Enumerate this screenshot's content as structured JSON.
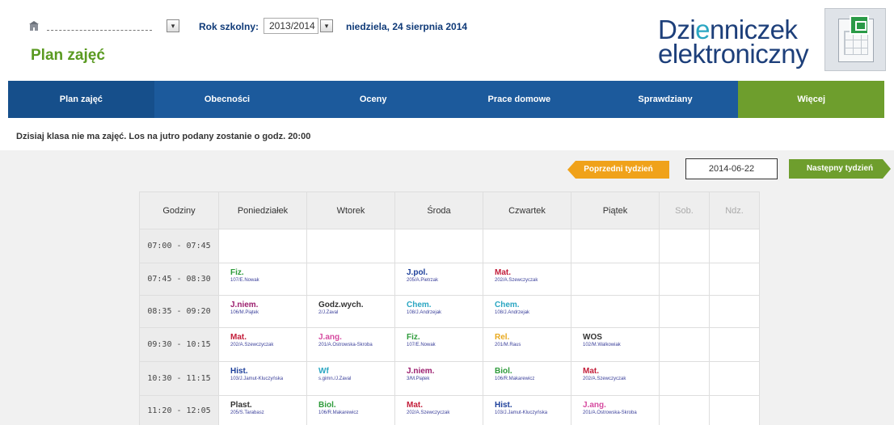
{
  "header": {
    "year_label": "Rok szkolny:",
    "year_value": "2013/2014",
    "date_text": "niedziela, 24 sierpnia 2014",
    "page_title": "Plan zajęć",
    "brand_line1_a": "Dzi",
    "brand_line1_b": "e",
    "brand_line1_c": "nniczek",
    "brand_line2": "elektroniczny"
  },
  "nav": [
    "Plan zajęć",
    "Obecności",
    "Oceny",
    "Prace domowe",
    "Sprawdziany",
    "Więcej"
  ],
  "info": "Dzisiaj klasa nie ma zajęć. Los na jutro podany zostanie o godz. 20:00",
  "week": {
    "prev_label": "Poprzedni tydzień",
    "date": "2014-06-22",
    "next_label": "Następny tydzień"
  },
  "colors": {
    "nav": "#1c5a9c",
    "green": "#6e9e2d",
    "orange": "#f0a21a",
    "title": "#5a9a21"
  },
  "timetable": {
    "headers": [
      "Godziny",
      "Poniedziałek",
      "Wtorek",
      "Środa",
      "Czwartek",
      "Piątek",
      "Sob.",
      "Ndz."
    ],
    "rows": [
      {
        "time": "07:00 - 07:45",
        "cells": [
          null,
          null,
          null,
          null,
          null,
          null,
          null
        ]
      },
      {
        "time": "07:45 - 08:30",
        "cells": [
          {
            "subject": "Fiz.",
            "room": "107/E.Nowak",
            "color": "#2d9b3a"
          },
          null,
          {
            "subject": "J.pol.",
            "room": "205/A.Pietrzak",
            "color": "#1d3f9a"
          },
          {
            "subject": "Mat.",
            "room": "202/A.Szewczyczak",
            "color": "#c31e3a"
          },
          null,
          null,
          null
        ]
      },
      {
        "time": "08:35 - 09:20",
        "cells": [
          {
            "subject": "J.niem.",
            "room": "106/M.Piątek",
            "color": "#9c1e6e"
          },
          {
            "subject": "Godz.wych.",
            "room": "2/J.Zaval",
            "color": "#333333"
          },
          {
            "subject": "Chem.",
            "room": "108/J.Andrzejak",
            "color": "#2aa6c2"
          },
          {
            "subject": "Chem.",
            "room": "108/J.Andrzejak",
            "color": "#2aa6c2"
          },
          null,
          null,
          null
        ]
      },
      {
        "time": "09:30 - 10:15",
        "cells": [
          {
            "subject": "Mat.",
            "room": "202/A.Szewczyczak",
            "color": "#c31e3a"
          },
          {
            "subject": "J.ang.",
            "room": "201/A.Ostrowska-Skroba",
            "color": "#d64ba0"
          },
          {
            "subject": "Fiz.",
            "room": "107/E.Nowak",
            "color": "#2d9b3a"
          },
          {
            "subject": "Rel.",
            "room": "201/M.Raus",
            "color": "#e8a81c"
          },
          {
            "subject": "WOS",
            "room": "102/M.Walkowiak",
            "color": "#333333"
          },
          null,
          null
        ]
      },
      {
        "time": "10:30 - 11:15",
        "cells": [
          {
            "subject": "Hist.",
            "room": "103/J.Jamut-Kluczyńska",
            "color": "#1d3f9a"
          },
          {
            "subject": "Wf",
            "room": "s.gimn./J.Zaval",
            "color": "#2aa6c2"
          },
          {
            "subject": "J.niem.",
            "room": "3/M.Piątek",
            "color": "#9c1e6e"
          },
          {
            "subject": "Biol.",
            "room": "106/R.Makarewicz",
            "color": "#2d9b3a"
          },
          {
            "subject": "Mat.",
            "room": "202/A.Szewczyczak",
            "color": "#c31e3a"
          },
          null,
          null
        ]
      },
      {
        "time": "11:20 - 12:05",
        "cells": [
          {
            "subject": "Plast.",
            "room": "205/S.Tarabasz",
            "color": "#333333"
          },
          {
            "subject": "Biol.",
            "room": "106/R.Makarewicz",
            "color": "#2d9b3a"
          },
          {
            "subject": "Mat.",
            "room": "202/A.Szewczyczak",
            "color": "#c31e3a"
          },
          {
            "subject": "Hist.",
            "room": "103/J.Jamut-Kluczyńska",
            "color": "#1d3f9a"
          },
          {
            "subject": "J.ang.",
            "room": "201/A.Ostrowska-Skroba",
            "color": "#d64ba0"
          },
          null,
          null
        ]
      }
    ]
  }
}
